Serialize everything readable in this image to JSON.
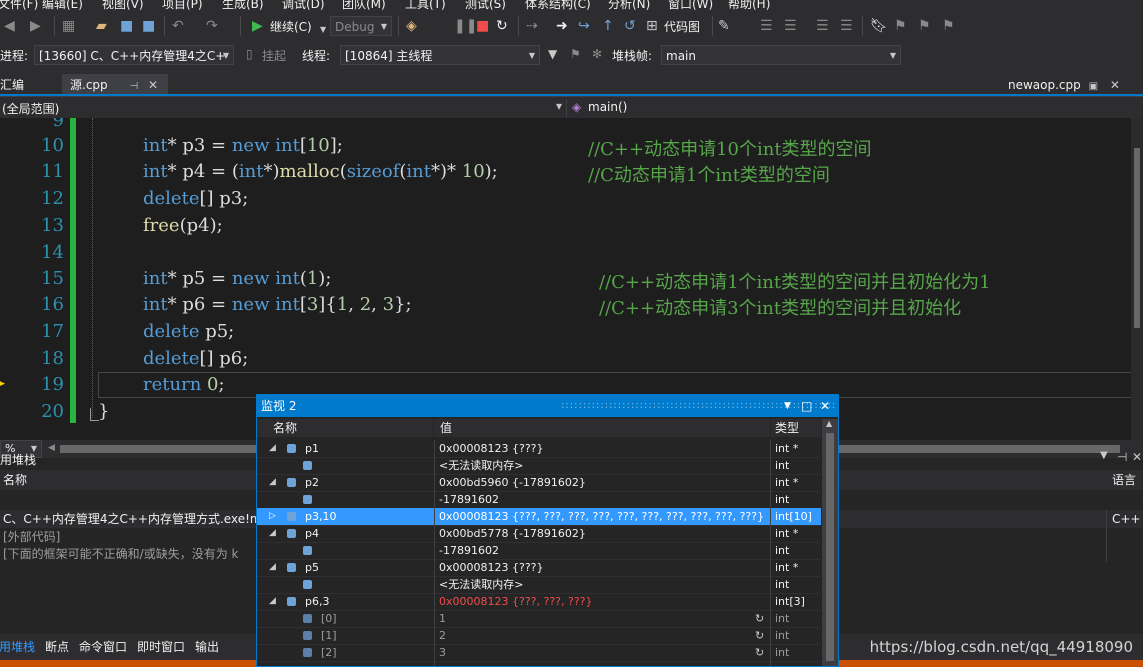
{
  "menu": {
    "items": [
      "文件(F)",
      "编辑(E)",
      "视图(V)",
      "项目(P)",
      "生成(B)",
      "调试(D)",
      "团队(M)",
      "工具(T)",
      "测试(S)",
      "体系结构(C)",
      "分析(N)",
      "窗口(W)",
      "帮助(H)"
    ]
  },
  "toolbar": {
    "continue_label": "继续(C)",
    "config_value": "Debug",
    "code_map_label": "代码图"
  },
  "debug_bar": {
    "process_label": "进程:",
    "process_value": "[13660] C、C++内存管理4之C+·",
    "suspend_label": "挂起",
    "thread_label": "线程:",
    "thread_value": "[10864] 主线程",
    "stack_frame_label": "堆栈帧:",
    "stack_frame_value": "main"
  },
  "tabs": {
    "left_partial": "汇编",
    "active": "源.cpp",
    "right": "newaop.cpp"
  },
  "navbar": {
    "scope": "(全局范围)",
    "function": "main()"
  },
  "editor": {
    "zoom": "%",
    "lines": [
      {
        "n": "9",
        "text": ""
      },
      {
        "n": "10",
        "code": "int* p3 = new int[10];",
        "comment": "//C++动态申请10个int类型的空间"
      },
      {
        "n": "11",
        "code": "int* p4 = (int*)malloc(sizeof(int*)* 10);",
        "comment": "//C动态申请1个int类型的空间"
      },
      {
        "n": "12",
        "code": "delete[] p3;",
        "comment": ""
      },
      {
        "n": "13",
        "code": "free(p4);",
        "comment": ""
      },
      {
        "n": "14",
        "code": "",
        "comment": ""
      },
      {
        "n": "15",
        "code": "int* p5 = new int(1);",
        "comment": "//C++动态申请1个int类型的空间并且初始化为1"
      },
      {
        "n": "16",
        "code": "int* p6 = new int[3]{1, 2, 3};",
        "comment": "//C++动态申请3个int类型的空间并且初始化"
      },
      {
        "n": "17",
        "code": "delete p5;",
        "comment": ""
      },
      {
        "n": "18",
        "code": "delete[] p6;",
        "comment": ""
      },
      {
        "n": "19",
        "code": "return 0;",
        "comment": ""
      },
      {
        "n": "20",
        "code": "}",
        "comment": ""
      }
    ]
  },
  "callstack": {
    "title": "用堆栈",
    "col_name": "名称",
    "col_lang": "语言",
    "rows": [
      {
        "name": "C、C++内存管理4之C++内存管理方式.exe!m",
        "lang": "C++"
      },
      {
        "name": "[外部代码]",
        "lang": ""
      },
      {
        "name": "[下面的框架可能不正确和/或缺失，没有为 k",
        "lang": ""
      }
    ]
  },
  "watch": {
    "title": "监视 2",
    "col_name": "名称",
    "col_value": "值",
    "col_type": "类型",
    "rows": [
      {
        "expander": "◢",
        "name": "p1",
        "value": "0x00008123 {???}",
        "type": "int *",
        "indent": 0
      },
      {
        "expander": "",
        "name": "",
        "value": "<无法读取内存>",
        "type": "int",
        "indent": 1
      },
      {
        "expander": "◢",
        "name": "p2",
        "value": "0x00bd5960 {-17891602}",
        "type": "int *",
        "indent": 0
      },
      {
        "expander": "",
        "name": "",
        "value": "-17891602",
        "type": "int",
        "indent": 1
      },
      {
        "expander": "▷",
        "name": "p3,10",
        "value": "0x00008123 {???, ???, ???, ???, ???, ???, ???, ???, ???, ???}",
        "type": "int[10]",
        "indent": 0,
        "selected": true
      },
      {
        "expander": "◢",
        "name": "p4",
        "value": "0x00bd5778 {-17891602}",
        "type": "int *",
        "indent": 0
      },
      {
        "expander": "",
        "name": "",
        "value": "-17891602",
        "type": "int",
        "indent": 1
      },
      {
        "expander": "◢",
        "name": "p5",
        "value": "0x00008123 {???}",
        "type": "int *",
        "indent": 0
      },
      {
        "expander": "",
        "name": "",
        "value": "<无法读取内存>",
        "type": "int",
        "indent": 1
      },
      {
        "expander": "◢",
        "name": "p6,3",
        "value": "0x00008123 {???, ???, ???}",
        "type": "int[3]",
        "indent": 0,
        "red": true
      },
      {
        "expander": "",
        "name": "[0]",
        "value": "1",
        "type": "int",
        "indent": 1,
        "stale": true
      },
      {
        "expander": "",
        "name": "[1]",
        "value": "2",
        "type": "int",
        "indent": 1,
        "stale": true
      },
      {
        "expander": "",
        "name": "[2]",
        "value": "3",
        "type": "int",
        "indent": 1,
        "stale": true
      }
    ]
  },
  "bottom_tabs": [
    "用堆栈",
    "断点",
    "命令窗口",
    "即时窗口",
    "输出"
  ],
  "watermark": "https://blog.csdn.net/qq_44918090",
  "colors": {
    "accent": "#007acc",
    "status": "#ca5100",
    "breakpoint_bar": "#28b53e"
  }
}
